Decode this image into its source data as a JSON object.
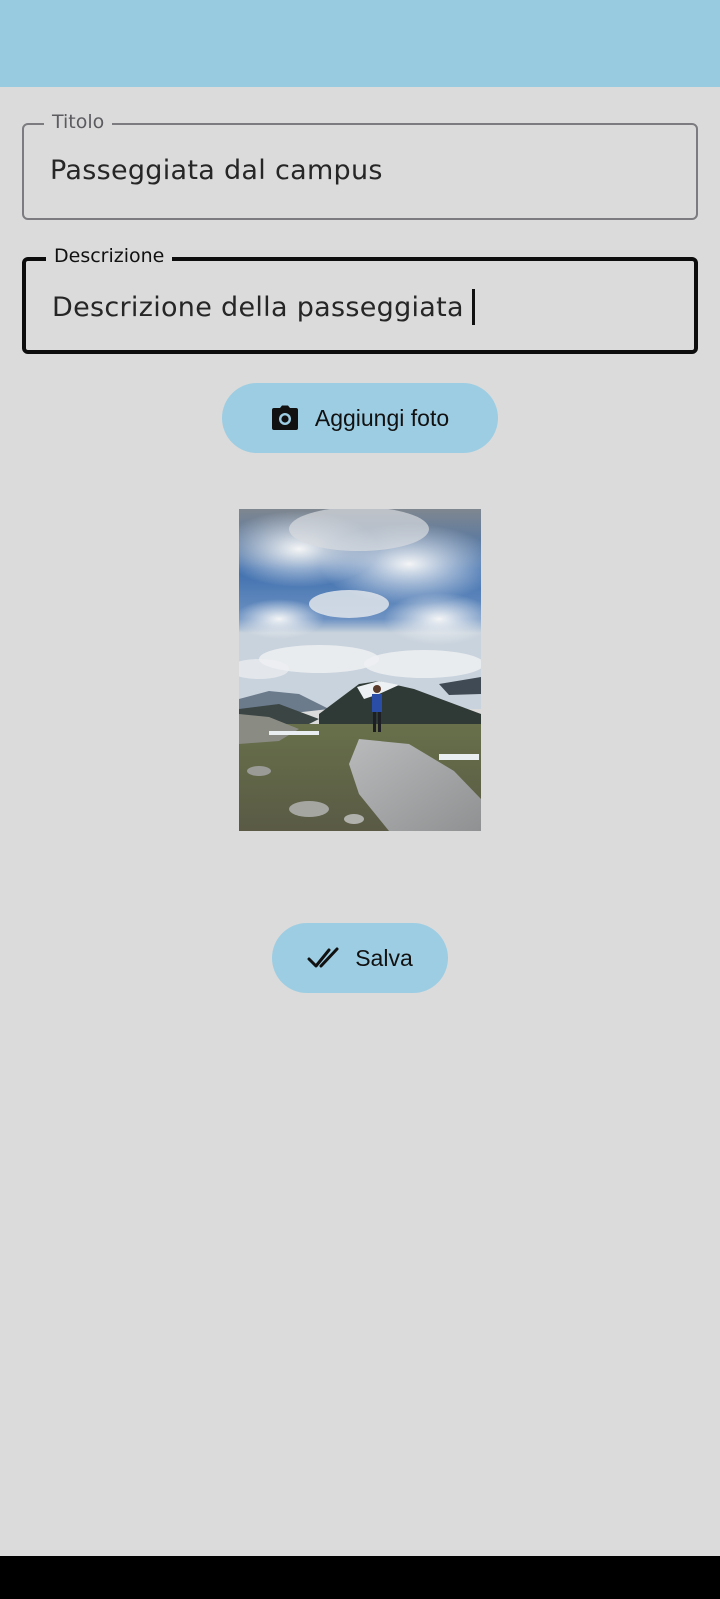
{
  "form": {
    "title_label": "Titolo",
    "title_value": "Passeggiata dal campus",
    "description_label": "Descrizione",
    "description_value": "Descrizione della passeggiata"
  },
  "buttons": {
    "add_photo_label": "Aggiungi foto",
    "add_photo_icon": "camera-icon",
    "save_label": "Salva",
    "save_icon": "double-check-icon"
  },
  "colors": {
    "top_bar": "#98cbe0",
    "background": "#dbdbdb",
    "button": "#9dcde2"
  }
}
